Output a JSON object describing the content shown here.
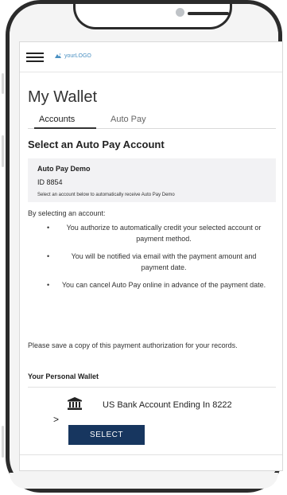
{
  "header": {
    "logo_text": "yourLOGO"
  },
  "page": {
    "title": "My Wallet"
  },
  "tabs": [
    {
      "label": "Accounts",
      "active": true
    },
    {
      "label": "Auto Pay",
      "active": false
    }
  ],
  "section": {
    "title": "Select an Auto Pay Account"
  },
  "demo_account": {
    "name": "Auto Pay Demo",
    "id": "ID 8854",
    "note": "Select an account below to automatically receive Auto Pay Demo"
  },
  "authorization": {
    "intro": "By selecting an account:",
    "bullets": [
      "You authorize to automatically credit your selected account or payment method.",
      "You will be notified via email with the payment amount and payment date.",
      "You can cancel Auto Pay online in advance of the payment date."
    ],
    "save_note": "Please save a copy of this payment authorization for your records."
  },
  "wallet": {
    "title": "Your Personal Wallet",
    "account_label": "US Bank Account Ending In 8222",
    "account_icon": "bank-icon",
    "chevron_icon": ">",
    "select_label": "SELECT"
  },
  "colors": {
    "brand": "#17365f",
    "logo_accent": "#4a90c2",
    "panel_bg": "#f2f2f4"
  }
}
